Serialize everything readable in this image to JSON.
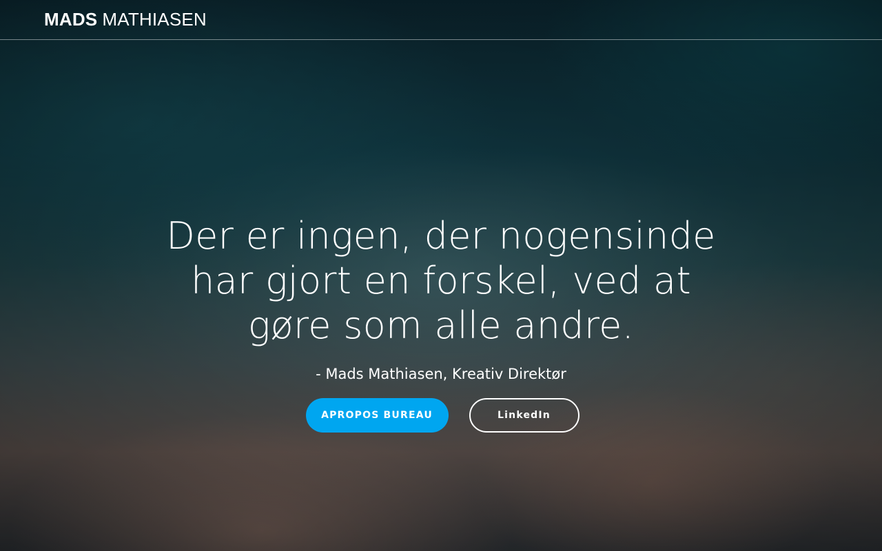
{
  "header": {
    "brand_first": "MADS",
    "brand_last": "MATHIASEN"
  },
  "hero": {
    "quote": "Der er ingen, der nogensinde har gjort en forskel, ved at gøre som alle andre.",
    "attribution": "- Mads Mathiasen, Kreativ Direktør",
    "primary_button_label": "APROPOS BUREAU",
    "secondary_button_label": "LinkedIn"
  },
  "colors": {
    "primary_button": "#00a6f0",
    "text": "#ffffff",
    "sky_top": "#0b2630",
    "sky_bottom": "#5a4f4b"
  }
}
